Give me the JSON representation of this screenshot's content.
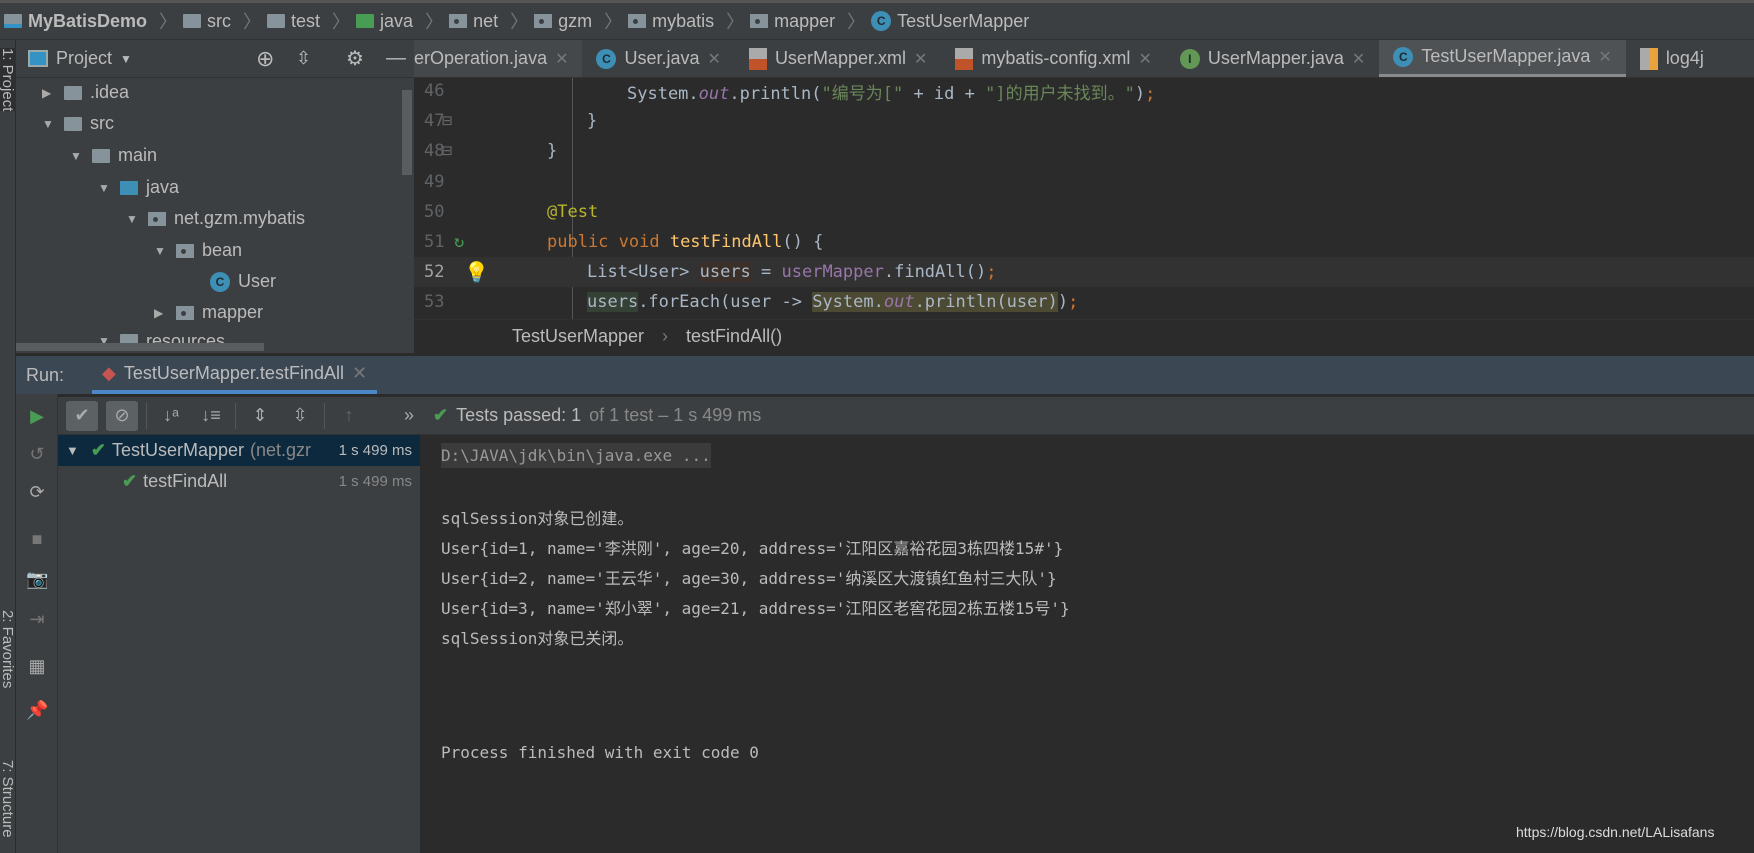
{
  "breadcrumb": [
    "MyBatisDemo",
    "src",
    "test",
    "java",
    "net",
    "gzm",
    "mybatis",
    "mapper",
    "TestUserMapper"
  ],
  "left_strip": {
    "project": "1: Project",
    "favorites": "2: Favorites",
    "structure": "7: Structure"
  },
  "project_panel": {
    "title": "Project",
    "tree": [
      {
        "label": ".idea",
        "icon": "folder-icon",
        "expanded": false
      },
      {
        "label": "src",
        "icon": "folder-icon",
        "expanded": true
      },
      {
        "label": "main",
        "icon": "folder-icon",
        "expanded": true
      },
      {
        "label": "java",
        "icon": "source-folder-icon",
        "expanded": true
      },
      {
        "label": "net.gzm.mybatis",
        "icon": "package-icon",
        "expanded": true
      },
      {
        "label": "bean",
        "icon": "package-icon",
        "expanded": true
      },
      {
        "label": "User",
        "icon": "class-icon"
      },
      {
        "label": "mapper",
        "icon": "package-icon",
        "expanded": false
      },
      {
        "label": "resources",
        "icon": "resources-folder-icon",
        "expanded": true
      }
    ]
  },
  "editor": {
    "tabs": [
      {
        "label": "erOperation.java",
        "icon": "class-icon"
      },
      {
        "label": "User.java",
        "icon": "class-icon"
      },
      {
        "label": "UserMapper.xml",
        "icon": "xml-icon"
      },
      {
        "label": "mybatis-config.xml",
        "icon": "xml-icon"
      },
      {
        "label": "UserMapper.java",
        "icon": "interface-icon"
      },
      {
        "label": "TestUserMapper.java",
        "icon": "test-class-icon",
        "active": true
      },
      {
        "label": "log4j",
        "icon": "properties-icon"
      }
    ],
    "line_numbers": [
      "46",
      "47",
      "48",
      "49",
      "50",
      "51",
      "52",
      "53"
    ],
    "breadcrumb": [
      "TestUserMapper",
      "testFindAll()"
    ]
  },
  "run": {
    "label": "Run:",
    "tab": "TestUserMapper.testFindAll",
    "status_passed": "Tests passed: 1",
    "status_detail": "of 1 test – 1 s 499 ms",
    "tree": [
      {
        "label": "TestUserMapper",
        "sub": "(net.gzr",
        "duration": "1 s 499 ms"
      },
      {
        "label": "testFindAll",
        "duration": "1 s 499 ms"
      }
    ],
    "console": {
      "command": "D:\\JAVA\\jdk\\bin\\java.exe ...",
      "lines": [
        "sqlSession对象已创建。",
        "User{id=1, name='李洪刚', age=20, address='江阳区嘉裕花园3栋四楼15#'}",
        "User{id=2, name='王云华', age=30, address='纳溪区大渡镇红鱼村三大队'}",
        "User{id=3, name='郑小翠', age=21, address='江阳区老窖花园2栋五楼15号'}",
        "sqlSession对象已关闭。"
      ],
      "exit": "Process finished with exit code 0"
    }
  },
  "watermark": "https://blog.csdn.net/LALisafans",
  "colors": {
    "accent": "#4a88c7",
    "pass": "#499c54",
    "keyword": "#cc7832",
    "string": "#6a8759"
  }
}
